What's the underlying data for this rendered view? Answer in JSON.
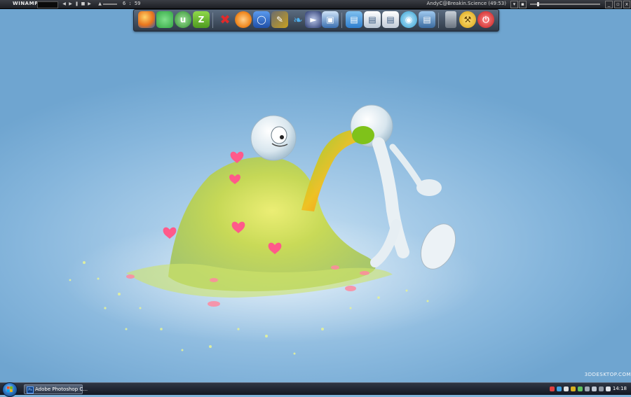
{
  "winamp": {
    "logo": "WINAMP",
    "time": "6 : 59",
    "track": "AndyC@Breakin.Science (49:53)",
    "controls": [
      "prev-icon",
      "play-icon",
      "pause-icon",
      "stop-icon",
      "next-icon",
      "eject-icon"
    ]
  },
  "dock": {
    "items": [
      {
        "name": "firefox-icon",
        "color": "#e8741c"
      },
      {
        "name": "messenger-icon",
        "color": "#34a845"
      },
      {
        "name": "utorrent-icon",
        "color": "#3cae3c"
      },
      {
        "name": "z-app-icon",
        "color": "#5db82a",
        "glyph": "Z"
      },
      {
        "name": "tools-icon",
        "color": "#d32a2a"
      },
      {
        "name": "orange-disc-icon",
        "color": "#f08a22"
      },
      {
        "name": "camera-icon",
        "color": "#2f6fd6"
      },
      {
        "name": "pencil-icon",
        "color": "#c8a020"
      },
      {
        "name": "feather-icon",
        "color": "#3b9bd6"
      },
      {
        "name": "media-icon",
        "color": "#2a3a70"
      },
      {
        "name": "window-icon",
        "color": "#3a6fb0"
      },
      {
        "name": "computer-icon",
        "color": "#2f7fcf"
      },
      {
        "name": "document-icon",
        "color": "#cfd8e4"
      },
      {
        "name": "document2-icon",
        "color": "#d7dee8"
      },
      {
        "name": "network-icon",
        "color": "#2f9fcf"
      },
      {
        "name": "folder-icon",
        "color": "#5e8fbf"
      },
      {
        "name": "trash-icon",
        "color": "#9aa4b0"
      },
      {
        "name": "tools2-icon",
        "color": "#e8b820"
      },
      {
        "name": "power-icon",
        "color": "#d62d2d"
      }
    ]
  },
  "taskbar": {
    "task_label": "Adobe Photoshop C...",
    "clock": "14:18",
    "tray_icons": [
      "volume-icon",
      "network-icon",
      "shield-icon",
      "speaker-icon"
    ]
  },
  "watermark": "3DDESKTOP.COM"
}
